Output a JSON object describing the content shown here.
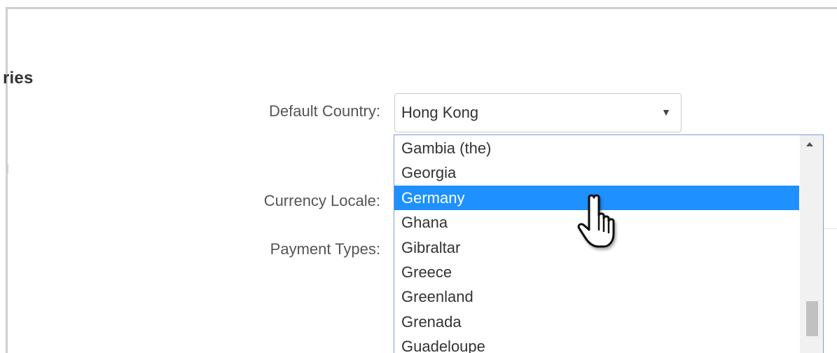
{
  "section": {
    "heading": "ries"
  },
  "form": {
    "default_country_label": "Default Country:",
    "currency_locale_label": "Currency Locale:",
    "payment_types_label": "Payment Types:"
  },
  "country_select": {
    "selected_value": "Hong Kong",
    "arrow_glyph": "▼",
    "options": [
      "Gambia (the)",
      "Georgia",
      "Germany",
      "Ghana",
      "Gibraltar",
      "Greece",
      "Greenland",
      "Grenada",
      "Guadeloupe"
    ],
    "highlighted_option": "Germany"
  },
  "icons": {
    "cursor": "hand-pointer-icon",
    "scroll_up": "chevron-up-icon"
  },
  "colors": {
    "highlight": "#1e90ff",
    "highlight_text": "#ffffff",
    "dropdown_border": "#7a9fd6",
    "label_text": "#555555"
  }
}
